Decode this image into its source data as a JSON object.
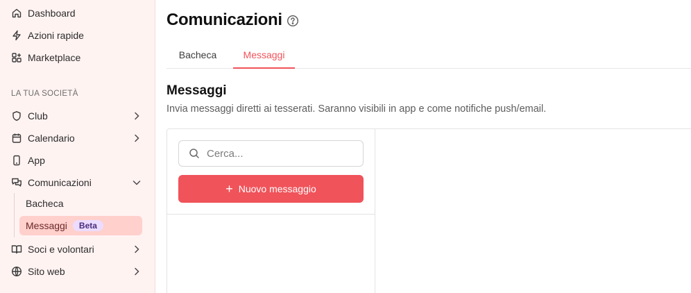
{
  "sidebar": {
    "top_items": [
      {
        "label": "Dashboard",
        "icon": "home-icon"
      },
      {
        "label": "Azioni rapide",
        "icon": "lightning-icon"
      },
      {
        "label": "Marketplace",
        "icon": "grid-plus-icon"
      }
    ],
    "section_label": "LA TUA SOCIETÀ",
    "items": [
      {
        "label": "Club",
        "icon": "shield-icon",
        "chevron": "right"
      },
      {
        "label": "Calendario",
        "icon": "calendar-icon",
        "chevron": "right"
      },
      {
        "label": "App",
        "icon": "phone-icon",
        "chevron": "none"
      },
      {
        "label": "Comunicazioni",
        "icon": "chat-icon",
        "chevron": "down"
      },
      {
        "label": "Soci e volontari",
        "icon": "book-icon",
        "chevron": "right"
      },
      {
        "label": "Sito web",
        "icon": "globe-icon",
        "chevron": "right"
      }
    ],
    "sub_items": [
      {
        "label": "Bacheca"
      },
      {
        "label": "Messaggi",
        "badge": "Beta",
        "active": true
      }
    ]
  },
  "main": {
    "title": "Comunicazioni",
    "tabs": [
      {
        "label": "Bacheca",
        "active": false
      },
      {
        "label": "Messaggi",
        "active": true
      }
    ],
    "section_title": "Messaggi",
    "section_desc": "Invia messaggi diretti ai tesserati. Saranno visibili in app e come notifiche push/email.",
    "search": {
      "placeholder": "Cerca...",
      "value": ""
    },
    "new_button_label": "Nuovo messaggio"
  },
  "colors": {
    "accent": "#f0535a",
    "sidebar_bg": "#fff3f2",
    "active_item_bg": "#ffd0cc",
    "badge_bg": "#ecdcff"
  }
}
